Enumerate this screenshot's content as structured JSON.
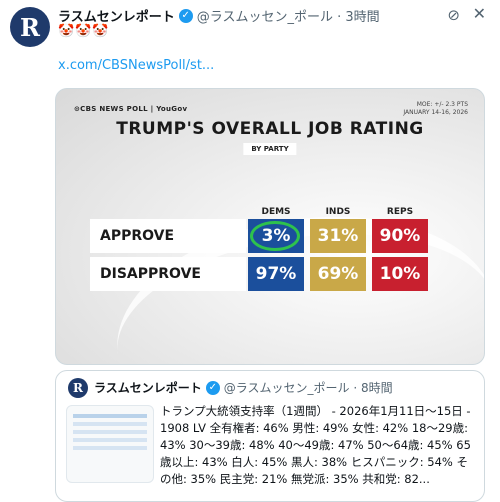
{
  "tweet": {
    "author_name": "ラスムセンレポート",
    "handle_time": "@ラスムッセン_ポール · 3時間",
    "emoji": "🤡🤡🤡",
    "link": "x.com/CBSNewsPoll/st..."
  },
  "chart_image": {
    "brand": "⊙CBS NEWS POLL | YouGov",
    "moe": "MOE: +/- 2.3 PTS",
    "dates": "JANUARY 14-16, 2026",
    "title": "TRUMP'S OVERALL JOB RATING",
    "subtitle": "BY PARTY",
    "columns": [
      "DEMS",
      "INDS",
      "REPS"
    ],
    "rows": [
      {
        "label": "APPROVE",
        "values": [
          "3%",
          "31%",
          "90%"
        ]
      },
      {
        "label": "DISAPPROVE",
        "values": [
          "97%",
          "69%",
          "10%"
        ]
      }
    ],
    "colors": {
      "dems": "#1b4f9c",
      "inds": "#c9a848",
      "reps": "#c8202f",
      "highlight": "#2ec24d"
    }
  },
  "quoted": {
    "author_name": "ラスムセンレポート",
    "handle_time": "@ラスムッセン_ポール · 8時間",
    "text": "トランプ大統領支持率（1週間） - 2026年1月11日～15日 - 1908 LV 全有権者: 46% 男性: 49% 女性: 42% 18～29歳: 43% 30～39歳: 48% 40～49歳: 47% 50～64歳: 45% 65歳以上: 43% 白人: 45% 黒人: 38% ヒスパニック: 54% その他: 35% 民主党: 21% 無党派: 35% 共和党: 82..."
  },
  "icons": {
    "verified": "verified-badge-icon",
    "grok": "grok-icon",
    "close": "close-icon"
  }
}
